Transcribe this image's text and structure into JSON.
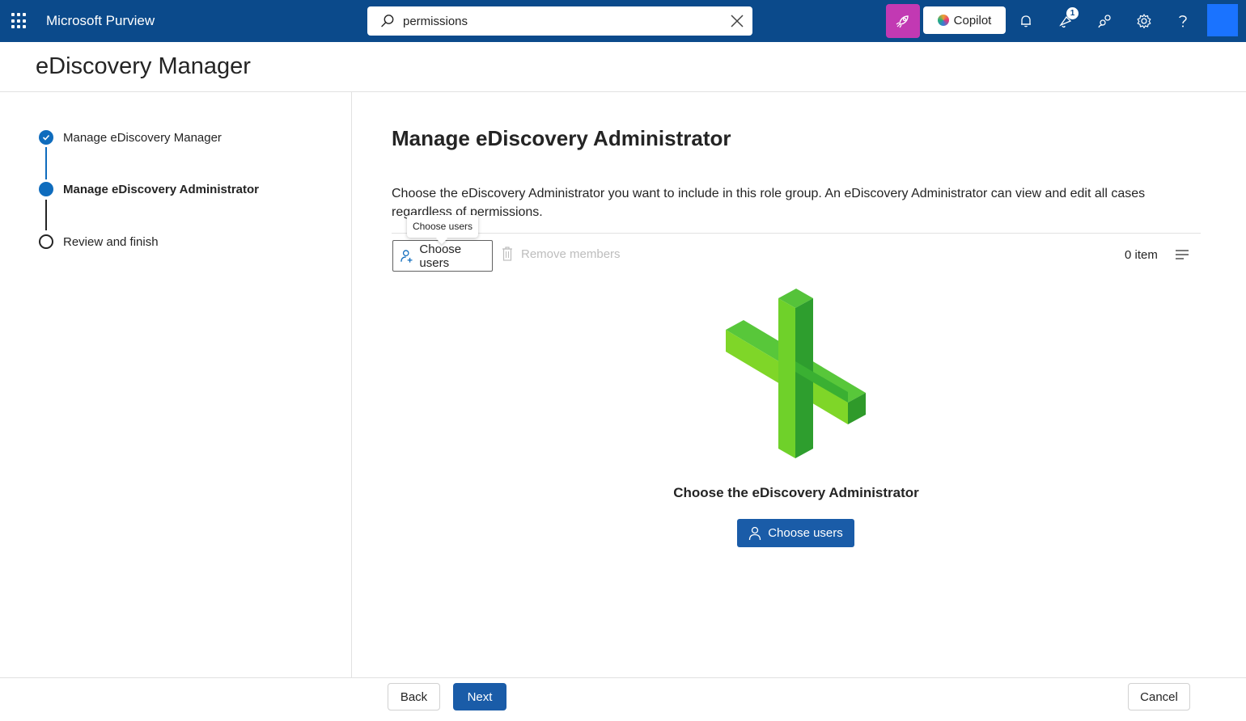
{
  "header": {
    "app_name": "Microsoft Purview",
    "search_value": "permissions",
    "copilot_label": "Copilot",
    "notification_badge": "1",
    "accent_color": "#0b4a8b"
  },
  "page": {
    "title": "eDiscovery Manager"
  },
  "wizard": {
    "steps": [
      {
        "label": "Manage eDiscovery Manager",
        "state": "completed"
      },
      {
        "label": "Manage eDiscovery Administrator",
        "state": "current"
      },
      {
        "label": "Review and finish",
        "state": "pending"
      }
    ]
  },
  "main": {
    "title": "Manage eDiscovery Administrator",
    "description": "Choose the eDiscovery Administrator you want to include in this role group. An eDiscovery Administrator can view and edit all cases regardless of permissions.",
    "toolbar": {
      "tooltip": "Choose users",
      "choose_users_label": "Choose users",
      "remove_members_label": "Remove members",
      "item_count": "0 item"
    },
    "empty_state": {
      "title": "Choose the eDiscovery Administrator",
      "button_label": "Choose users"
    }
  },
  "footer": {
    "back_label": "Back",
    "next_label": "Next",
    "cancel_label": "Cancel"
  }
}
